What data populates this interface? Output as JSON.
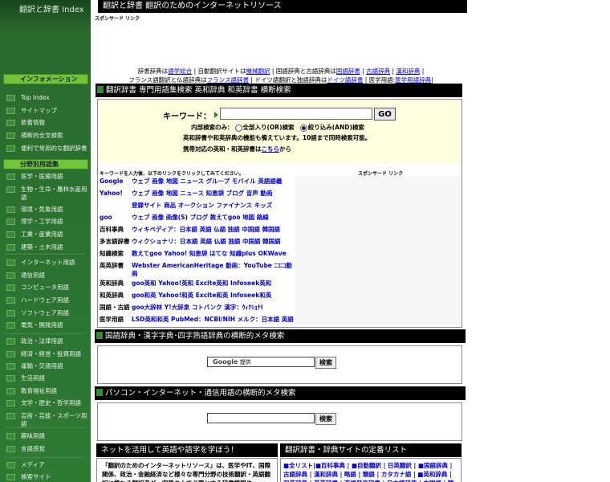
{
  "sidebar": {
    "logo": "翻訳と辞書 Index",
    "section1": "インフォメーション",
    "info_items": [
      "Top Index",
      "サイトマップ",
      "新着情報",
      "横断的全文検索",
      "便利で常用的な翻訳辞書"
    ],
    "section2": "分野別用語集",
    "field_items": [
      "医学・医療用語",
      "生物・生命・農林水産用語",
      "環境・気象用語",
      "理学・工学用語",
      "工業・産業用語",
      "建築・土木用語",
      "インターネット用語",
      "通信用語",
      "コンピュータ用語",
      "ハードウェア用語",
      "ソフトウェア用語",
      "電気・開発用語",
      "政治・法律用語",
      "経済・経営・投資用語",
      "運輸・交通用語",
      "生活用語",
      "教育福祉用語",
      "文学・歴史・哲学用語",
      "芸術・芸能・スポーツ用語",
      "趣味用語",
      "言語感覚",
      "メディア",
      "検索サイト"
    ]
  },
  "header": {
    "title": "翻訳と辞書   翻訳のためのインターネットリソース",
    "sponsor": "スポンサード リンク"
  },
  "links": {
    "line1": [
      {
        "t": "辞書辞典は",
        "link": false
      },
      {
        "t": "語学総合",
        "link": true
      },
      {
        "t": " | 自動翻訳サイトは",
        "link": false
      },
      {
        "t": "機械翻訳",
        "link": true
      },
      {
        "t": " | 国語辞典と古語辞典は",
        "link": false
      },
      {
        "t": "国語辞書",
        "link": true
      },
      {
        "t": " | ",
        "link": false
      },
      {
        "t": "古語辞典",
        "link": true
      },
      {
        "t": " | ",
        "link": false
      },
      {
        "t": "漢和辞典",
        "link": true
      },
      {
        "t": " |",
        "link": false
      }
    ],
    "line2": [
      {
        "t": "フランス語翻訳と仏語辞典は",
        "link": false
      },
      {
        "t": "フランス語辞書",
        "link": true
      },
      {
        "t": " | ドイツ語翻訳と独語辞典は",
        "link": false
      },
      {
        "t": "ドイツ語辞書",
        "link": true
      },
      {
        "t": " | 医学用語:",
        "link": false
      },
      {
        "t": "医学用語辞典",
        "link": true
      },
      {
        "t": "|",
        "link": false
      }
    ]
  },
  "section1": {
    "head": "翻訳辞書   専門用語集検索  英和辞典 和英辞書  横断検索",
    "keyword_label": "キーワード：",
    "keyword_value": "",
    "go": "GO",
    "mode_label": "内部検索のみ：",
    "mode_or": "全部入り(OR)検索",
    "mode_and": "絞り込み(AND)検索",
    "info1": "英和辞書や和英辞典の機能も備えています。10語まで同時検索可能。",
    "info2_prefix": "携帯対応の英和・和英辞書は",
    "info2_link": "こちら",
    "info2_suffix": "から",
    "instruction": "キーワードを入力後、以下のリンクをクリックしてみてください。",
    "sponsor": "スポンサード リンク",
    "rows": [
      {
        "cat": "Google",
        "blue": true,
        "links": "ウェブ 画像 地図 ニュース グループ モバイル 英語語義"
      },
      {
        "cat": "Yahoo!",
        "blue": true,
        "links": "ウェブ 画像 地図 ニュース 知恵袋 ブログ 音声 動画"
      },
      {
        "cat": "",
        "blue": false,
        "links": "登録サイト 商品 オークション ファイナンス キッズ"
      },
      {
        "cat": "goo",
        "blue": true,
        "links": "ウェブ 画像 画像(S) ブログ 教えてgoo 地図 路線"
      },
      {
        "cat": "百科事典",
        "blue": false,
        "links": "ウィキペディア：日本語 英語 仏語 独語 中国語 韓国語"
      },
      {
        "cat": "多言語辞書",
        "blue": false,
        "links": "ウィクショナリ：日本語 英語 仏語 独語 中国語 韓国語"
      },
      {
        "cat": "知識検索",
        "blue": false,
        "links": "教えてgoo Yahoo! 知恵袋 はてな 知識plus OKWave"
      },
      {
        "cat": "英英辞書",
        "blue": false,
        "links": "Webster AmericanHeritage   動画：YouTube ﾆｺﾆｺ動画"
      },
      {
        "cat": "英和辞典",
        "blue": false,
        "links": "goo英和    Yahoo!英和    Excite英和    Infoseek英和"
      },
      {
        "cat": "和英辞典",
        "blue": false,
        "links": "goo和英    Yahoo!和英    Excite和英    Infoseek和英"
      },
      {
        "cat": "国語・古語",
        "blue": false,
        "links": "goo大辞林 Y!大辞泉 コトバンク     漢字：ｳｨｸｼｮﾅﾘ"
      },
      {
        "cat": "医学用語",
        "blue": false,
        "links": "LSD英和和英    PubMed：NCBI/NIH    メルク：日本語 英語"
      }
    ]
  },
  "section2": {
    "head": "国語辞典・漢字字典･四字熟語辞典の横断的メタ検索",
    "google_text": "Google",
    "google_sub": "提供",
    "button": "検索"
  },
  "section3": {
    "head": "パソコン・インターネット・通信用語の横断的メタ検索",
    "input_value": "",
    "button": "検索"
  },
  "bottom_left": {
    "head": "ネットを活用して英語や語学を学ぼう！",
    "text": "「翻訳のためのインターネットリソース」は、医学やIT、国際関係、政治・金融経済など様々な専門分野の技術翻訳・英語翻訳に携わる翻訳者が、実務の上で必要とする辞書情報や"
  },
  "bottom_right": {
    "head": "翻訳辞書・辞典サイトの定番リスト",
    "text": "■全リスト|■百科事典 | ■自動翻訳 | 日英翻訳 | ■国語辞典 | 古語辞典 | 漢和辞典 | 略語 | 類語 | カタカナ語 | ■英和辞典 | 和英辞典 | 英英辞書 | 英語発音辞書 | 日本語辞典 | 中国語 | 韓国語 | フランス語"
  }
}
